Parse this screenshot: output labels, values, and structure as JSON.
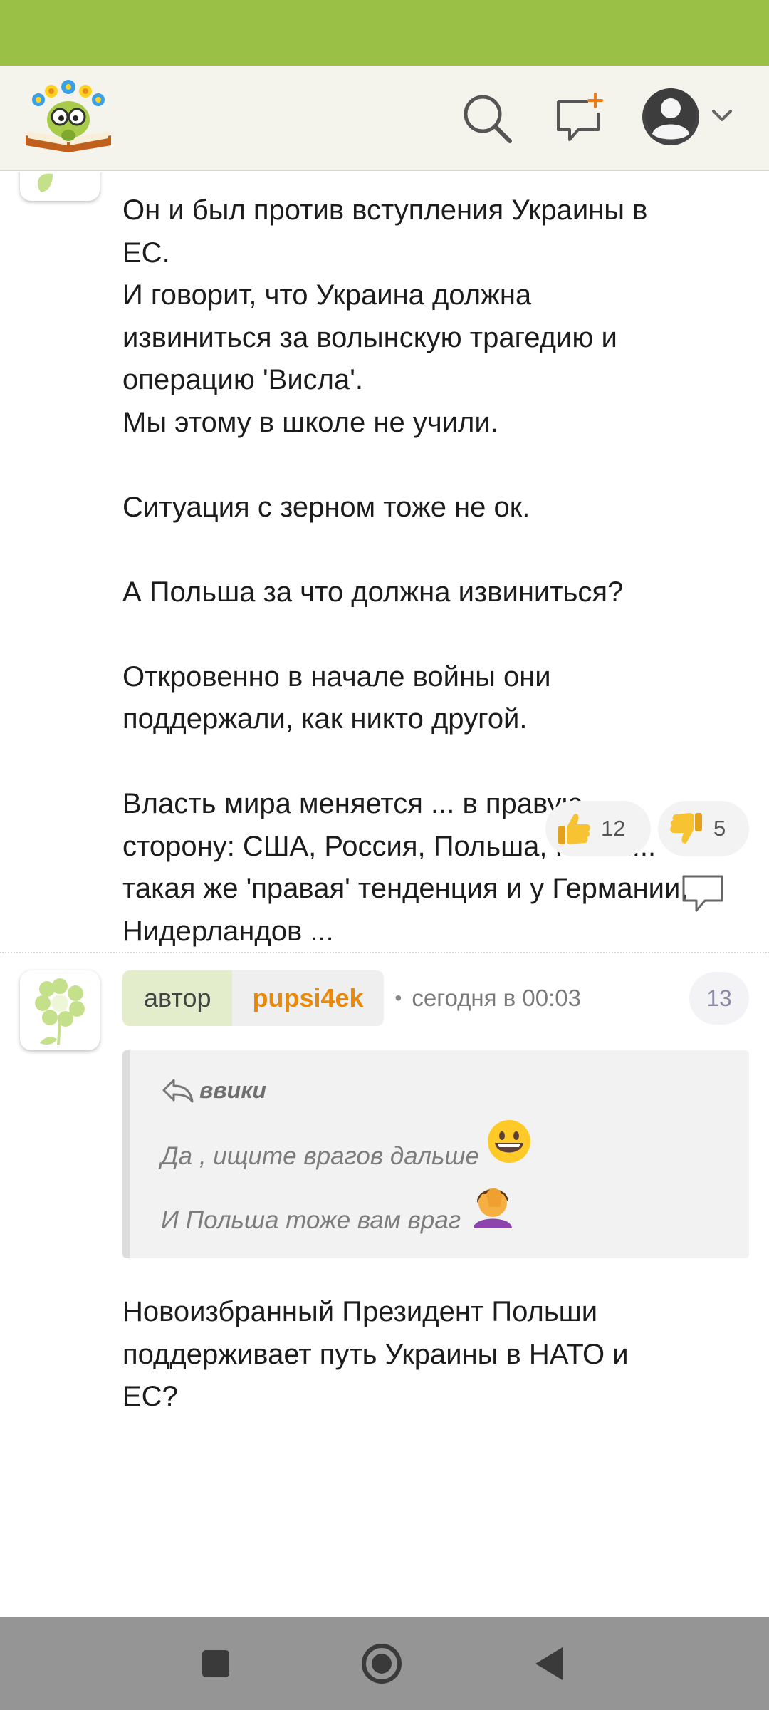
{
  "colors": {
    "status_bar": "#9bc046",
    "header_bg": "#f4f4ec",
    "author_name": "#e8890c",
    "author_tag_bg": "#e3edcb",
    "nav_bar": "#959595"
  },
  "header": {
    "logo_icon": "book-character-logo",
    "search_icon": "search-icon",
    "new_message_icon": "new-message-icon",
    "profile_icon": "user-avatar-icon"
  },
  "comment1": {
    "paragraphs": [
      [
        "Он и был против вступления Украины в",
        "ЕС.",
        "И говорит, что Украина должна",
        "извиниться за волынскую трагедию и",
        "операцию 'Висла'.",
        "Мы этому в школе не учили."
      ],
      [
        "Ситуация с зерном тоже не ок."
      ],
      [
        "А Польша за что должна извиниться?"
      ],
      [
        "Откровенно в начале войны они",
        "поддержали, как никто другой."
      ],
      [
        "Власть мира меняется ... в правую",
        "сторону: США, Россия, Польша, Китай...",
        "такая же 'правая' тенденция и у Германии,",
        "Нидерландов ..."
      ]
    ],
    "likes": "12",
    "dislikes": "5"
  },
  "comment2": {
    "author_label": "автор",
    "author_name": "pupsi4ek",
    "separator": "•",
    "time": "сегодня в 00:03",
    "number": "13",
    "quote": {
      "author": "ввики",
      "line1": "Да , ищите врагов дальше",
      "line1_emoji": "😀",
      "line2": "И Польша тоже вам враг",
      "line2_emoji": "🤦‍♀️"
    },
    "lines": [
      "Новоизбранный Президент Польши",
      "поддерживает путь Украины в НАТО и",
      "ЕС?"
    ]
  }
}
